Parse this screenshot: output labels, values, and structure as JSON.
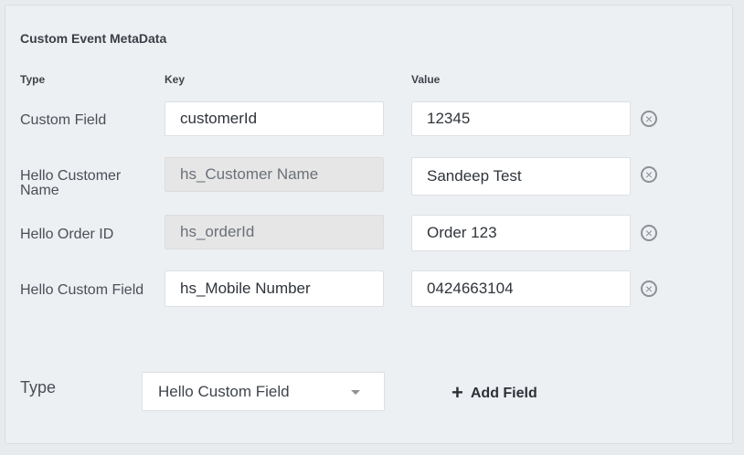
{
  "section": {
    "title": "Custom Event MetaData"
  },
  "headers": {
    "type": "Type",
    "key": "Key",
    "value": "Value"
  },
  "rows": [
    {
      "type": "Custom Field",
      "key": "customerId",
      "value": "12345",
      "key_editable": true
    },
    {
      "type": "Hello Customer Name",
      "type_line1": "Hello Customer",
      "type_line2": "Name",
      "key": "hs_Customer Name",
      "value": "Sandeep Test",
      "key_editable": false
    },
    {
      "type": "Hello Order ID",
      "key": "hs_orderId",
      "value": "Order 123",
      "key_editable": false
    },
    {
      "type": "Hello Custom Field",
      "key": "hs_Mobile Number",
      "value": "0424663104",
      "key_editable": true
    }
  ],
  "footer": {
    "type_label": "Type",
    "type_selected": "Hello Custom Field",
    "add_button_label": "Add Field",
    "add_icon": "plus-icon"
  },
  "icons": {
    "remove": "close-circle-icon",
    "dropdown": "caret-down-icon"
  }
}
